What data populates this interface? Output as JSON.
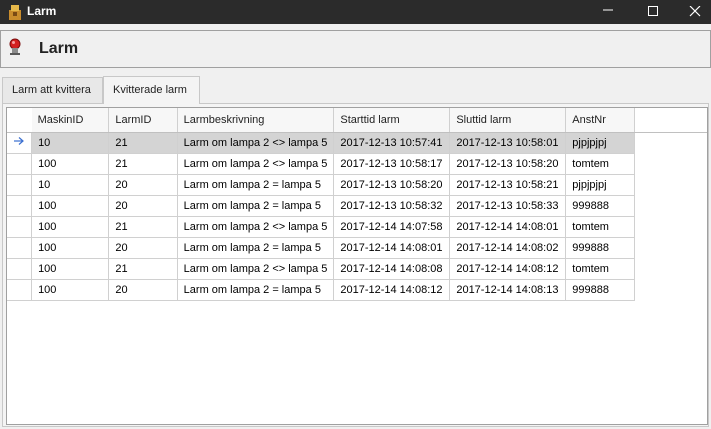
{
  "window": {
    "title": "Larm"
  },
  "header": {
    "title": "Larm"
  },
  "tabs": [
    {
      "label": "Larm att kvittera"
    },
    {
      "label": "Kvitterade larm"
    }
  ],
  "grid": {
    "columns": [
      "MaskinID",
      "LarmID",
      "Larmbeskrivning",
      "Starttid larm",
      "Sluttid larm",
      "AnstNr"
    ],
    "rows": [
      [
        "10",
        "21",
        "Larm om lampa 2 <> lampa 5",
        "2017-12-13 10:57:41",
        "2017-12-13 10:58:01",
        "pjpjpjpj"
      ],
      [
        "100",
        "21",
        "Larm om lampa 2 <> lampa 5",
        "2017-12-13 10:58:17",
        "2017-12-13 10:58:20",
        "tomtem"
      ],
      [
        "10",
        "20",
        "Larm om lampa 2 = lampa 5",
        "2017-12-13 10:58:20",
        "2017-12-13 10:58:21",
        "pjpjpjpj"
      ],
      [
        "100",
        "20",
        "Larm om lampa 2 = lampa 5",
        "2017-12-13 10:58:32",
        "2017-12-13 10:58:33",
        "999888"
      ],
      [
        "100",
        "21",
        "Larm om lampa 2 <> lampa 5",
        "2017-12-14 14:07:58",
        "2017-12-14 14:08:01",
        "tomtem"
      ],
      [
        "100",
        "20",
        "Larm om lampa 2 = lampa 5",
        "2017-12-14 14:08:01",
        "2017-12-14 14:08:02",
        "999888"
      ],
      [
        "100",
        "21",
        "Larm om lampa 2 <> lampa 5",
        "2017-12-14 14:08:08",
        "2017-12-14 14:08:12",
        "tomtem"
      ],
      [
        "100",
        "20",
        "Larm om lampa 2 = lampa 5",
        "2017-12-14 14:08:12",
        "2017-12-14 14:08:13",
        "999888"
      ]
    ]
  },
  "icons": {
    "app": "app-icon",
    "header": "alarm-bell-icon",
    "current_row": "arrow-right-icon",
    "minimize": "minimize-icon",
    "maximize": "maximize-icon",
    "close": "close-icon"
  },
  "colors": {
    "titlebar": "#2b2b2b",
    "selected_row": "#d4d4d4",
    "row_arrow": "#3a6fd0"
  }
}
